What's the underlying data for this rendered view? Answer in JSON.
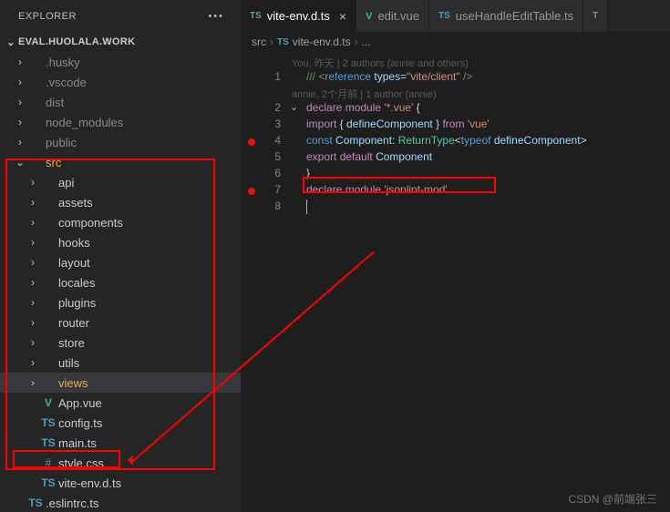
{
  "sidebar": {
    "title": "EXPLORER",
    "root": "EVAL.HUOLALA.WORK",
    "folders_top": [
      ".husky",
      ".vscode",
      "dist",
      "node_modules",
      "public"
    ],
    "src": "src",
    "src_children": [
      "api",
      "assets",
      "components",
      "hooks",
      "layout",
      "locales",
      "plugins",
      "router",
      "store",
      "utils"
    ],
    "views": "views",
    "files": [
      {
        "icon": "V",
        "cls": "vue",
        "name": "App.vue"
      },
      {
        "icon": "TS",
        "cls": "ts",
        "name": "config.ts"
      },
      {
        "icon": "TS",
        "cls": "ts",
        "name": "main.ts"
      },
      {
        "icon": "#",
        "cls": "hash",
        "name": "style.css"
      },
      {
        "icon": "TS",
        "cls": "ts",
        "name": "vite-env.d.ts"
      }
    ],
    "trailing": ".eslintrc.ts"
  },
  "tabs": [
    {
      "icon": "TS",
      "cls": "ts",
      "label": "vite-env.d.ts",
      "active": true,
      "close": true
    },
    {
      "icon": "V",
      "cls": "vue",
      "label": "edit.vue",
      "active": false,
      "close": false
    },
    {
      "icon": "TS",
      "cls": "ts",
      "label": "useHandleEditTable.ts",
      "active": false,
      "close": false
    }
  ],
  "crumbs": [
    "src",
    "vite-env.d.ts",
    "..."
  ],
  "crumb_icon": "TS",
  "blame1": "You, 昨天 | 2 authors (annie and others)",
  "blame2": "annie, 2个月前 | 1 author (annie)",
  "code": {
    "l1": {
      "a": "/// <",
      "b": "reference",
      "c": " types",
      "d": "=",
      "e": "\"vite/client\"",
      "f": " />"
    },
    "l2": {
      "a": "declare",
      "b": " module",
      "c": " '*.vue'",
      "d": " {"
    },
    "l3": {
      "a": "import",
      "b": " { ",
      "c": "defineComponent",
      "d": " } ",
      "e": "from",
      "f": " 'vue'"
    },
    "l4": {
      "a": "const",
      "b": " Component",
      "c": ": ",
      "d": "ReturnType",
      "e": "<",
      "f": "typeof",
      "g": " defineComponent",
      "h": ">"
    },
    "l5": {
      "a": "export",
      "b": " default",
      "c": " Component"
    },
    "l6": "}",
    "l7": {
      "a": "declare",
      "b": " module",
      "c": " 'jsonlint-mod'"
    }
  },
  "watermark": "CSDN @前端张三"
}
